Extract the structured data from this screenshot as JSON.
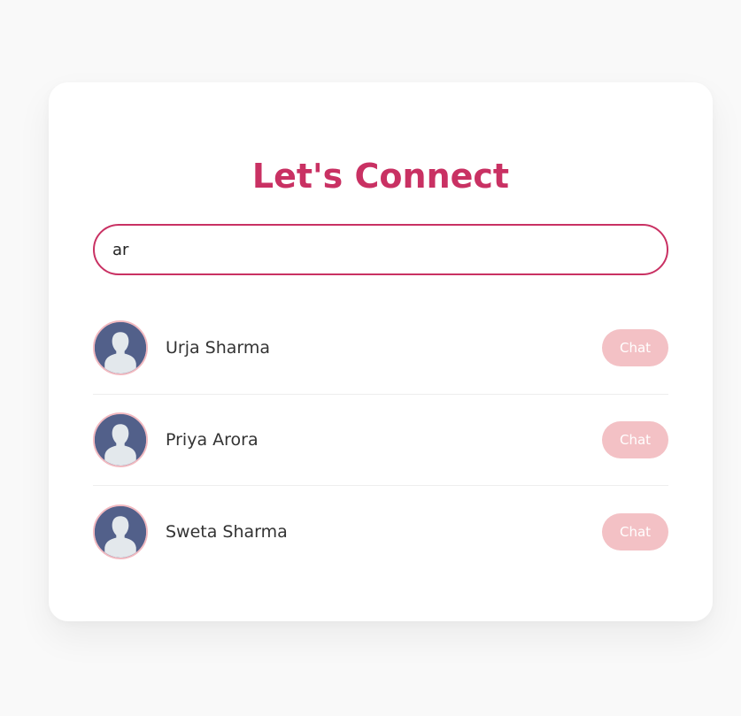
{
  "app": {
    "title": "Let's Connect"
  },
  "search": {
    "value": "ar"
  },
  "contacts": [
    {
      "name": "Urja Sharma",
      "action_label": "Chat"
    },
    {
      "name": "Priya Arora",
      "action_label": "Chat"
    },
    {
      "name": "Sweta Sharma",
      "action_label": "Chat"
    }
  ],
  "colors": {
    "accent": "#c93163",
    "button": "#f3c1c5",
    "avatar_bg": "#52608a",
    "avatar_border": "#f1b9c0"
  },
  "icons": {
    "avatar": "user-silhouette-icon"
  }
}
